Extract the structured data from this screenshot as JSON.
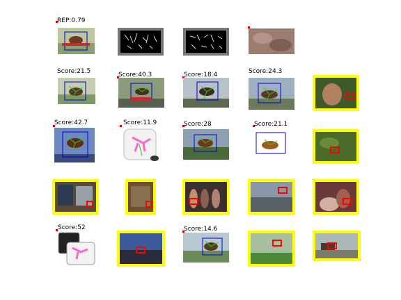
{
  "figure": {
    "row1": {
      "label": "REP:0.79"
    },
    "scores": [
      "Score:21.5",
      "Score:40.3",
      "Score:18.4",
      "Score:24.3",
      "Score:42.7",
      "Score:11.9",
      "Score:28",
      "Score:21.1",
      "Score:52",
      "Score:14.6"
    ]
  },
  "colors": {
    "highlight": "#ffff00",
    "box_blue": "#0000cc",
    "box_red": "#ff0000",
    "skeleton_green": "#22cc22",
    "skeleton_pink": "#ff66cc"
  }
}
